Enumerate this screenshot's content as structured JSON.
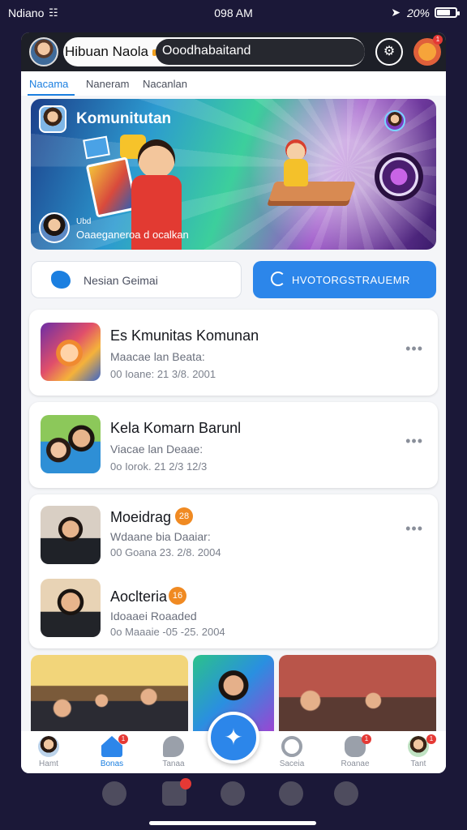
{
  "status_bar": {
    "carrier": "Ndiano",
    "time": "098 AM",
    "battery_text": "20%"
  },
  "header": {
    "app_name": "Hibuan Naola",
    "search_text": "Ooodhabaitand"
  },
  "tabs": [
    {
      "label": "Nacama",
      "active": true
    },
    {
      "label": "Naneram"
    },
    {
      "label": "Nacanlan"
    }
  ],
  "banner": {
    "title": "Komunitutan",
    "caption": "Ubd",
    "subtitle": "Oaaeganeroa d ocalkan"
  },
  "actions": {
    "secondary_label": "Nesian Geimai",
    "primary_label": "HVOTORGSTRAUEMR"
  },
  "feed": [
    {
      "title": "Es Kmunitas Komunan",
      "subtitle": "Maacae lan Beata:",
      "date": "00 Ioane: 21 3/8. 2001"
    },
    {
      "title": "Kela  Komarn Barunl",
      "subtitle": "Viacae lan Deaae:",
      "date": "0o  Iorok. 21 2/3 12/3"
    },
    {
      "title": "Moeidrag",
      "badge": "28",
      "subtitle": "Wdaane bia Daaiar:",
      "date": "00 Goana 23. 2/8. 2004"
    },
    {
      "title": "Aoclteria",
      "badge": "16",
      "subtitle": "Idoaaei Roaaded",
      "date": "0o  Maaaie -05 -25. 2004"
    }
  ],
  "bottom_nav": [
    {
      "label": "Hamt",
      "icon": "profile-avatar-icon",
      "active": false
    },
    {
      "label": "Bonas",
      "icon": "home-icon",
      "active": true,
      "badge": "1"
    },
    {
      "label": "Tanaa",
      "icon": "chat-bubble-icon"
    },
    {
      "label": "Saceia",
      "icon": "search-icon"
    },
    {
      "label": "Roanae",
      "icon": "groups-icon",
      "badge": "1"
    },
    {
      "label": "Tant",
      "icon": "profile-icon",
      "badge": "1"
    }
  ],
  "colors": {
    "accent": "#2c86ea",
    "header_bg": "#1d1f27",
    "badge_red": "#e53935",
    "badge_orange": "#f08a22",
    "screen_bg": "#1b1838"
  }
}
